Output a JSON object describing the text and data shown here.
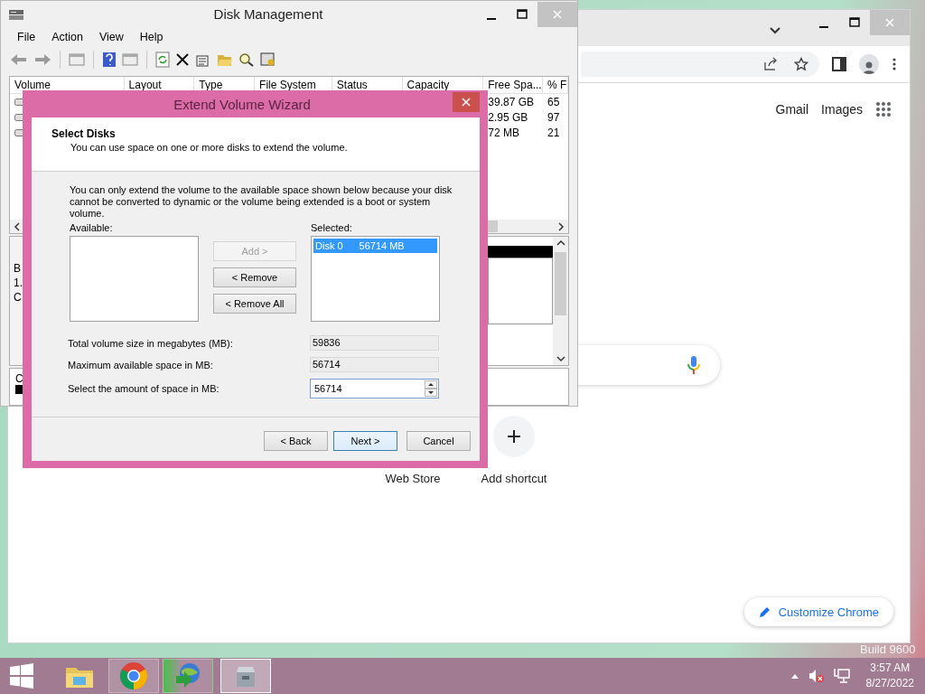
{
  "browser": {
    "links": [
      "Gmail",
      "Images"
    ],
    "shortcuts": [
      {
        "label": "Web Store",
        "kind": "hidden"
      },
      {
        "label": "Add shortcut",
        "kind": "add"
      }
    ],
    "customize_button": "Customize Chrome"
  },
  "desktop": {
    "build_text": "Build 9600"
  },
  "disk_management": {
    "title": "Disk Management",
    "menu": [
      "File",
      "Action",
      "View",
      "Help"
    ],
    "columns": [
      "Volume",
      "Layout",
      "Type",
      "File System",
      "Status",
      "Capacity",
      "Free Spa...",
      "% F"
    ],
    "rows": [
      {
        "free_space": "39.87 GB",
        "percent_free": "65"
      },
      {
        "free_space": "2.95 GB",
        "percent_free": "97"
      },
      {
        "free_space": "72 MB",
        "percent_free": "21"
      }
    ],
    "disk_labels": [
      "B",
      "1.",
      "C"
    ],
    "cdrom_label": "C"
  },
  "wizard": {
    "title": "Extend Volume Wizard",
    "heading": "Select Disks",
    "subheading": "You can use space on one or more disks to extend the volume.",
    "note": "You can only extend the volume to the available space shown below because your disk cannot be converted to dynamic or the volume being extended is a boot or system volume.",
    "available_label": "Available:",
    "selected_label": "Selected:",
    "selected_items": [
      {
        "disk": "Disk 0",
        "size": "56714 MB",
        "selected": true
      }
    ],
    "buttons": [
      {
        "label": "Add >",
        "disabled": true
      },
      {
        "label": "< Remove",
        "disabled": false
      },
      {
        "label": "< Remove All",
        "disabled": false
      }
    ],
    "fields": [
      {
        "label": "Total volume size in megabytes (MB):",
        "value": "59836",
        "editable": false
      },
      {
        "label": "Maximum available space in MB:",
        "value": "56714",
        "editable": false
      },
      {
        "label": "Select the amount of space in MB:",
        "value": "56714",
        "editable": true
      }
    ],
    "footer_buttons": [
      {
        "label": "< Back",
        "default": false
      },
      {
        "label": "Next >",
        "default": true
      },
      {
        "label": "Cancel",
        "default": false
      }
    ]
  },
  "taskbar": {
    "apps": [
      {
        "kind": "explorer",
        "active": false
      },
      {
        "kind": "chrome",
        "active": false
      },
      {
        "kind": "download",
        "active": false
      },
      {
        "kind": "disk",
        "active": true
      }
    ],
    "clock": {
      "time": "3:57 AM",
      "date": "8/27/2022"
    }
  }
}
